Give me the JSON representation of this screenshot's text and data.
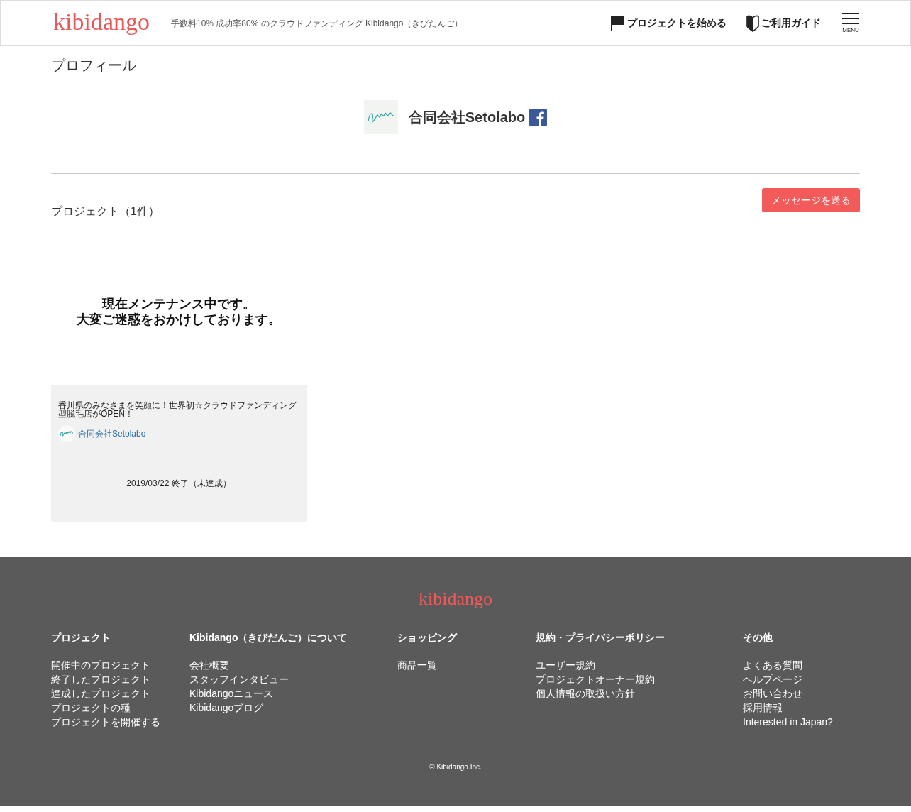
{
  "header": {
    "logo": "kibidango",
    "tagline": "手数料10% 成功率80% のクラウドファンディング Kibidango（きびだんご）",
    "nav": [
      {
        "kind": "flag",
        "label": "プロジェクトを始める"
      },
      {
        "kind": "guide",
        "label": "ご利用ガイド"
      },
      {
        "kind": "menu",
        "label": "MENU"
      }
    ]
  },
  "page_title": "プロフィール",
  "profile": {
    "name": "合同会社Setolabo"
  },
  "message_button": "メッセージを送る",
  "projects_heading": "プロジェクト（1件）",
  "projects": [
    {
      "image_text": [
        "現在メンテナンス中です。",
        "大変ご迷惑をおかけしております。"
      ],
      "title": "香川県のみなさまを笑顔に！世界初☆クラウドファンディング型脱毛店がOPEN！",
      "owner": "合同会社Setolabo",
      "status": "2019/03/22 終了（未達成）"
    }
  ],
  "footer": {
    "logo": "kibidango",
    "columns": [
      {
        "heading": "プロジェクト",
        "links": [
          "開催中のプロジェクト",
          "終了したプロジェクト",
          "達成したプロジェクト",
          "プロジェクトの種",
          "プロジェクトを開催する"
        ]
      },
      {
        "heading": "Kibidango（きびだんご）について",
        "links": [
          "会社概要",
          "スタッフインタビュー",
          "Kibidangoニュース",
          "Kibidangoブログ"
        ]
      },
      {
        "heading": "ショッピング",
        "links": [
          "商品一覧"
        ]
      },
      {
        "heading": "規約・プライバシーポリシー",
        "links": [
          "ユーザー規約",
          "プロジェクトオーナー規約",
          "個人情報の取扱い方針"
        ]
      },
      {
        "heading": "その他",
        "links": [
          "よくある質問",
          "ヘルプページ",
          "お問い合わせ",
          "採用情報",
          "Interested in Japan?"
        ]
      }
    ],
    "copyright": "© Kibidango Inc."
  }
}
